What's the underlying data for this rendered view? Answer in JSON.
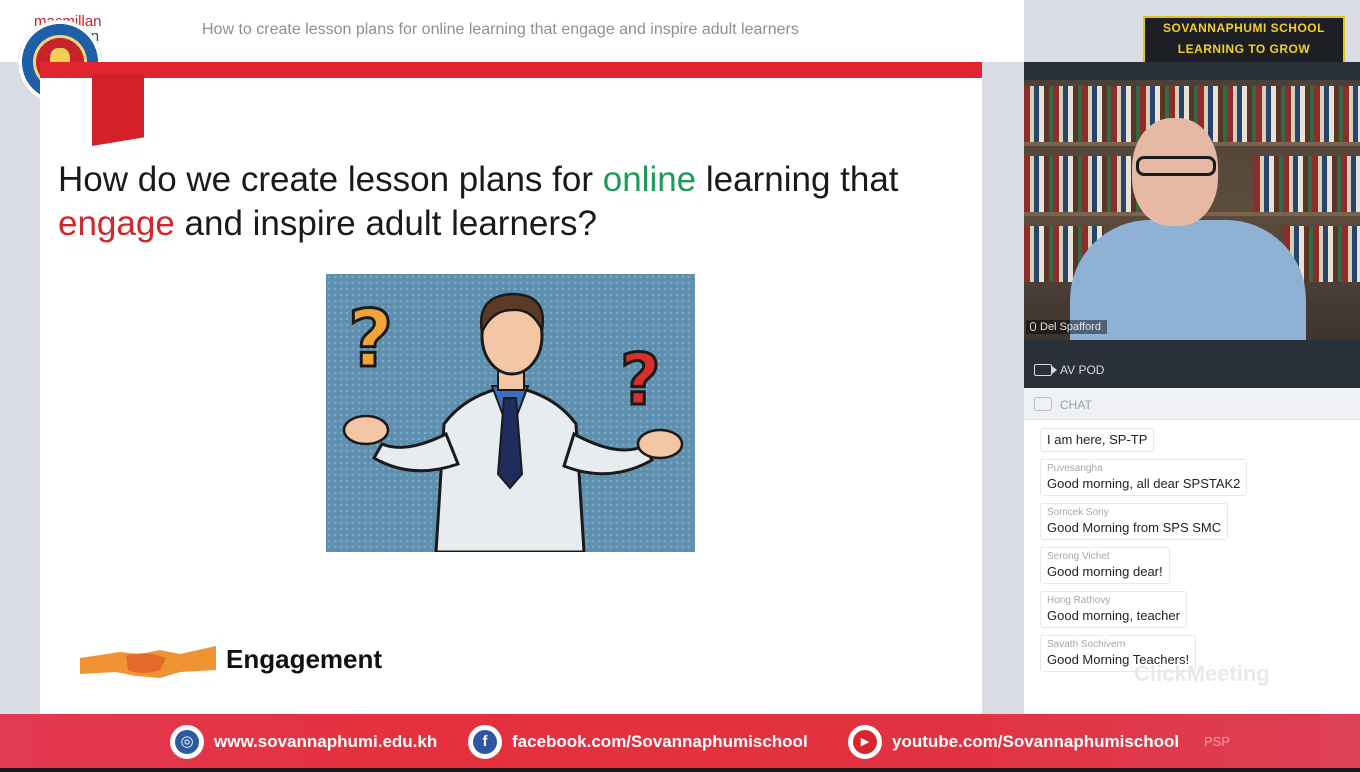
{
  "topbar": {
    "publisher_top": "macmillan",
    "publisher_bottom": "education",
    "session_title": "How to create lesson plans for online learning that engage and inspire adult learners"
  },
  "brand": {
    "line1": "SOVANNAPHUMI SCHOOL",
    "line2": "LEARNING TO GROW"
  },
  "slide": {
    "heading_part1": "How do we create lesson plans for ",
    "heading_online": "online",
    "heading_part2": " learning that ",
    "heading_engage": "engage",
    "heading_part3": " and inspire adult learners?",
    "engagement_label": "Engagement"
  },
  "video": {
    "participant_name": "Del Spafford"
  },
  "pod": {
    "label": "AV POD"
  },
  "chat": {
    "label": "CHAT",
    "messages": [
      {
        "sender": "",
        "text": "I am here, SP-TP"
      },
      {
        "sender": "Puvesangha",
        "text": "Good morning, all dear SPSTAK2"
      },
      {
        "sender": "Somcek Sony",
        "text": "Good Morning from SPS SMC"
      },
      {
        "sender": "Serong Vichet",
        "text": "Good morning dear!"
      },
      {
        "sender": "Hong Rathovy",
        "text": "Good morning, teacher"
      },
      {
        "sender": "Savath Sochivern",
        "text": "Good Morning Teachers!"
      }
    ],
    "watermark": "ClickMeeting"
  },
  "footer": {
    "website": "www.sovannaphumi.edu.kh",
    "facebook": "facebook.com/Sovannaphumischool",
    "youtube": "youtube.com/Sovannaphumischool",
    "faded_tag": "PSP"
  },
  "colors": {
    "accent_red": "#e0252e",
    "online_green": "#1e9a5a",
    "brand_yellow": "#f1d128",
    "footer_red": "#e5303e"
  }
}
